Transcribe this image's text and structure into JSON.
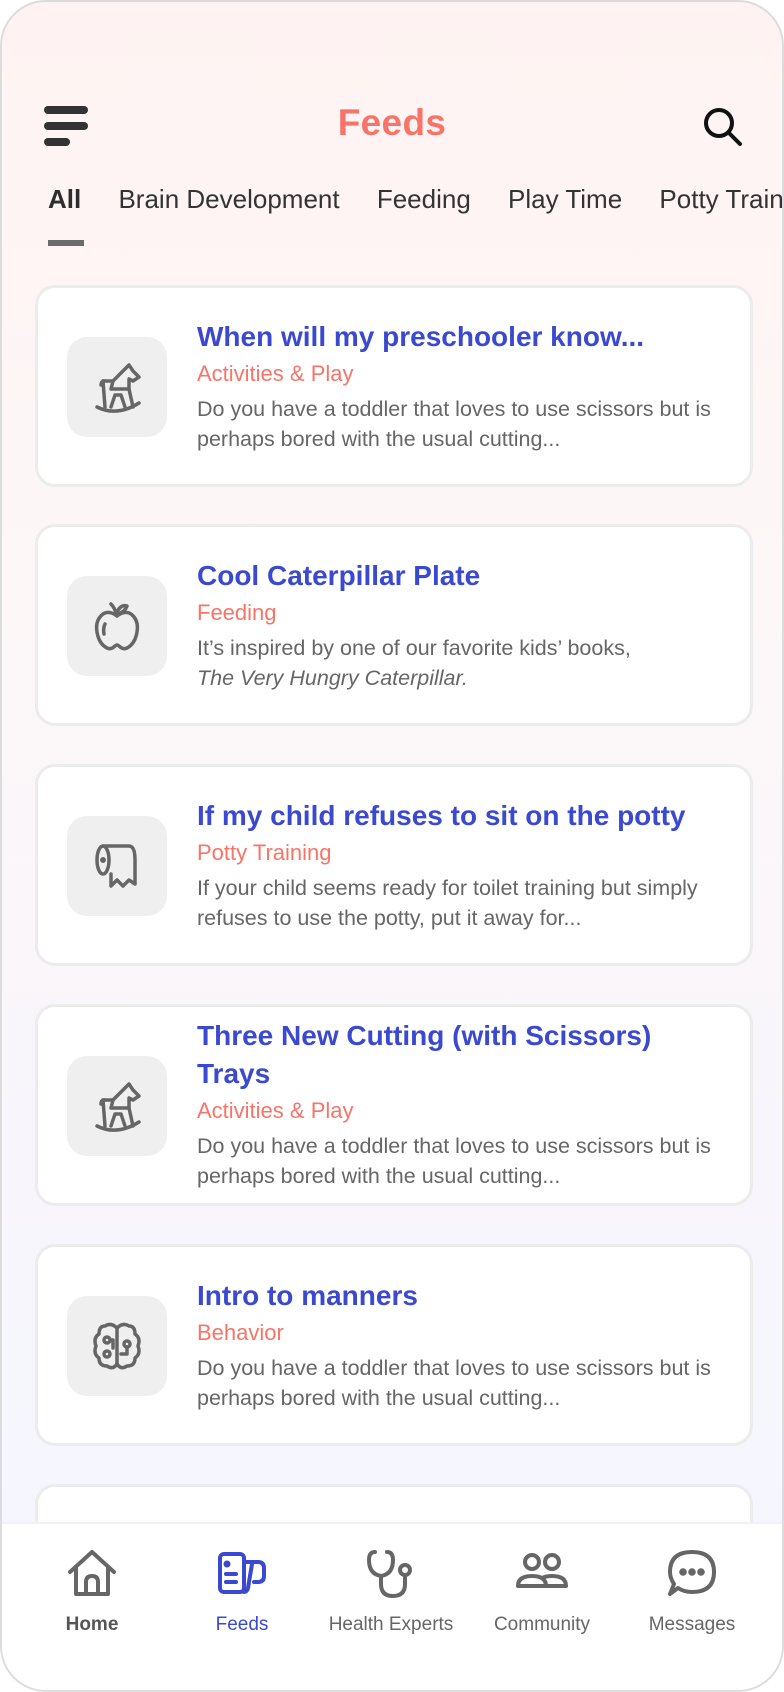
{
  "header": {
    "title": "Feeds",
    "menu_icon": "hamburger-menu-icon",
    "search_icon": "search-icon"
  },
  "tabs": [
    {
      "label": "All",
      "active": true
    },
    {
      "label": "Brain Development",
      "active": false
    },
    {
      "label": "Feeding",
      "active": false
    },
    {
      "label": "Play Time",
      "active": false
    },
    {
      "label": "Potty Training",
      "active": false
    }
  ],
  "feed": [
    {
      "icon": "rocking-horse-icon",
      "title": "When will my preschooler know...",
      "category": "Activities & Play",
      "description": "Do you have a toddler that loves to use scissors but is perhaps bored with the usual cutting..."
    },
    {
      "icon": "apple-icon",
      "title": "Cool Caterpillar Plate",
      "category": "Feeding",
      "description": "It’s inspired by one of our favorite kids’ books,",
      "description_italic": "The Very Hungry Caterpillar."
    },
    {
      "icon": "toilet-paper-icon",
      "title": "If my child refuses to sit on the potty",
      "category": "Potty Training",
      "description": "If your child seems ready for toilet training but simply refuses to use the potty, put it away for..."
    },
    {
      "icon": "rocking-horse-icon",
      "title": "Three New Cutting (with Scissors) Trays",
      "category": "Activities & Play",
      "description": "Do you have a toddler that loves to use scissors but is perhaps bored with the usual cutting..."
    },
    {
      "icon": "brain-icon",
      "title": "Intro to manners",
      "category": "Behavior",
      "description": "Do you have a toddler that loves to use scissors but is perhaps bored with the usual cutting..."
    }
  ],
  "bottom_nav": [
    {
      "label": "Home",
      "icon": "home-icon",
      "active": false
    },
    {
      "label": "Feeds",
      "icon": "feeds-icon",
      "active": true
    },
    {
      "label": "Health Experts",
      "icon": "stethoscope-icon",
      "active": false
    },
    {
      "label": "Community",
      "icon": "community-icon",
      "active": false
    },
    {
      "label": "Messages",
      "icon": "chat-bubble-icon",
      "active": false
    }
  ],
  "colors": {
    "accent_coral": "#f87469",
    "accent_blue": "#3a49cf",
    "text_gray": "#666666"
  }
}
